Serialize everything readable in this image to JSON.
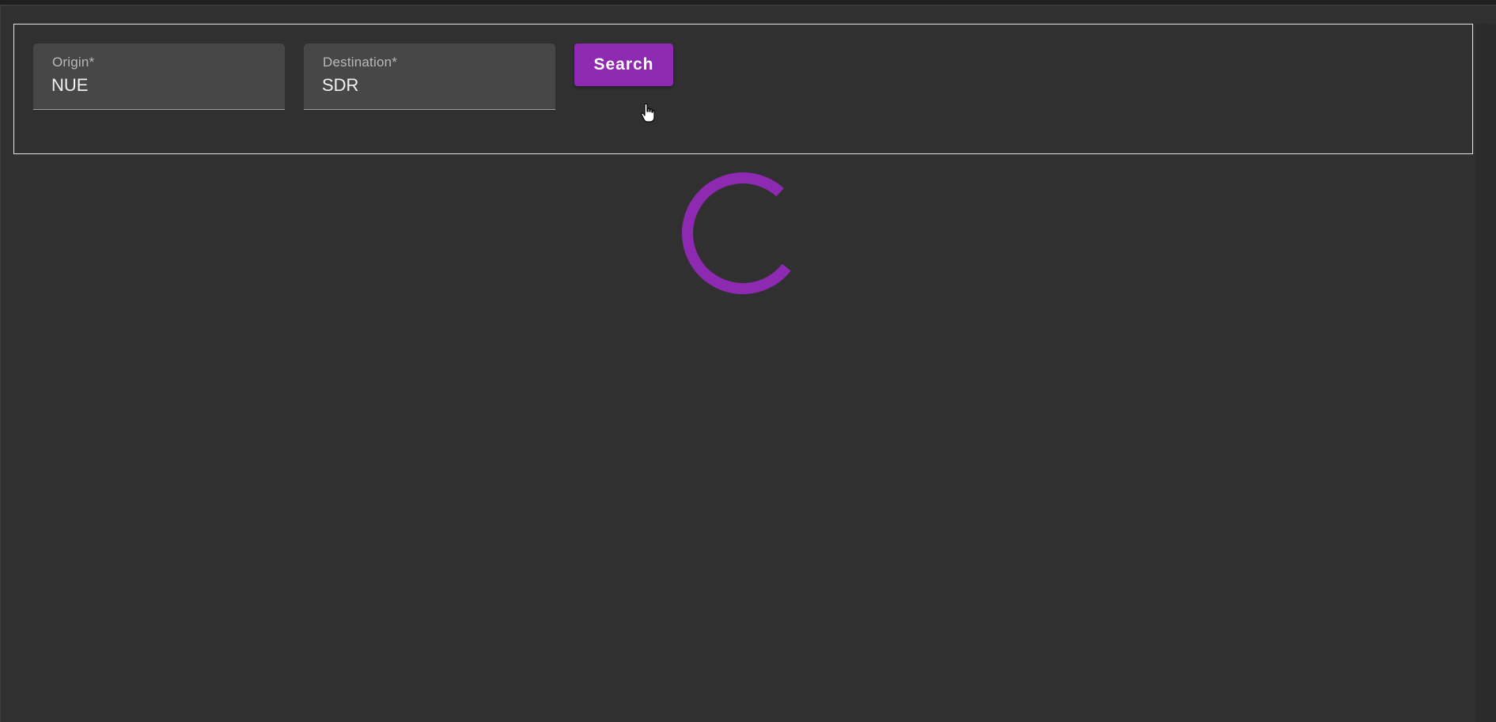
{
  "search": {
    "origin": {
      "label": "Origin*",
      "value": "NUE"
    },
    "destination": {
      "label": "Destination*",
      "value": "SDR"
    },
    "button_label": "Search"
  },
  "loading": {
    "spinner_color": "#8e2ab2",
    "state": "loading"
  },
  "colors": {
    "background": "#303030",
    "accent": "#8e2ab2",
    "field_background": "#474747"
  }
}
